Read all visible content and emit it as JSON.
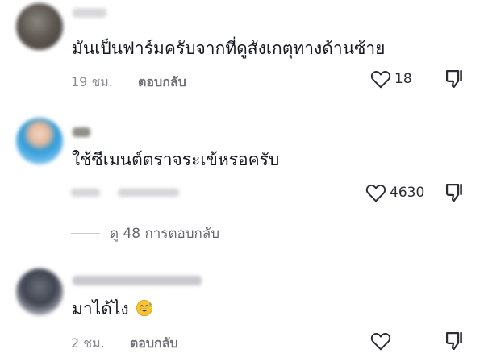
{
  "comments": [
    {
      "text": "มันเป็นฟาร์มครับจากที่ดูสังเกตุทางด้านซ้าย",
      "time": "19 ชม.",
      "reply_label": "ตอบกลับ",
      "likes": "18"
    },
    {
      "text": "ใช้ซีเมนต์ตราจระเข้หรอครับ",
      "likes": "4630",
      "view_replies": "ดู 48 การตอบกลับ"
    },
    {
      "text": "มาได้ไง",
      "time": "2 ชม.",
      "reply_label": "ตอบกลับ",
      "emoji": "grinning-sweat-emoji"
    }
  ],
  "colors": {
    "text": "#161823",
    "meta": "#8a8b91",
    "icon": "#2b2c33"
  },
  "icons": {
    "like": "heart-outline-icon",
    "dislike": "thumbs-down-icon"
  }
}
